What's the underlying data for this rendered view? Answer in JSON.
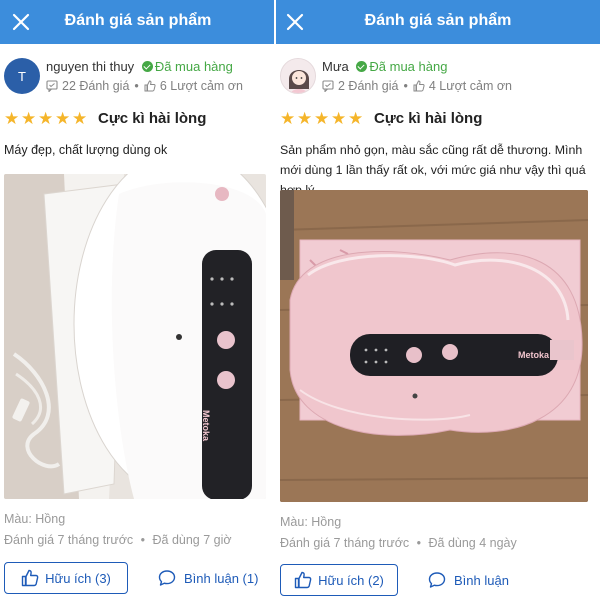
{
  "left": {
    "header_title": "Đánh giá sản phẩm",
    "avatar_letter": "T",
    "reviewer_name": "nguyen thi thuy",
    "verified_label": "Đã mua hàng",
    "review_count": "22 Đánh giá",
    "thanks_count": "6 Lượt cảm ơn",
    "rating_stars": 5,
    "rating_label": "Cực kì hài lòng",
    "comment": "Máy đẹp, chất lượng dùng ok",
    "device_brand": "Metoka",
    "color_line": "Màu: Hồng",
    "time_line": "Đánh giá 7 tháng trước",
    "usage_line": "Đã dùng 7 giờ",
    "helpful_button": "Hữu ích (3)",
    "comment_button": "Bình luận (1)"
  },
  "right": {
    "header_title": "Đánh giá sản phẩm",
    "reviewer_name": "Mưa",
    "verified_label": "Đã mua hàng",
    "review_count": "2 Đánh giá",
    "thanks_count": "4 Lượt cảm ơn",
    "rating_stars": 5,
    "rating_label": "Cực kì hài lòng",
    "comment": "Sản phẩm nhỏ gọn, màu sắc cũng rất dễ thương. Mình mới dùng 1 lần thấy rất ok, với mức giá như vậy thì quá hợp lý.",
    "device_brand": "Metoka",
    "color_line": "Màu: Hồng",
    "time_line": "Đánh giá 7 tháng trước",
    "usage_line": "Đã dùng 4 ngày",
    "helpful_button": "Hữu ích (2)",
    "comment_button": "Bình luận"
  },
  "separator": "•",
  "colors": {
    "header_bg": "#3c8ddc",
    "accent_blue": "#1e5bb8",
    "verified_green": "#45a845",
    "star_yellow": "#f5b52a",
    "meta_gray": "#9a9a9a"
  }
}
